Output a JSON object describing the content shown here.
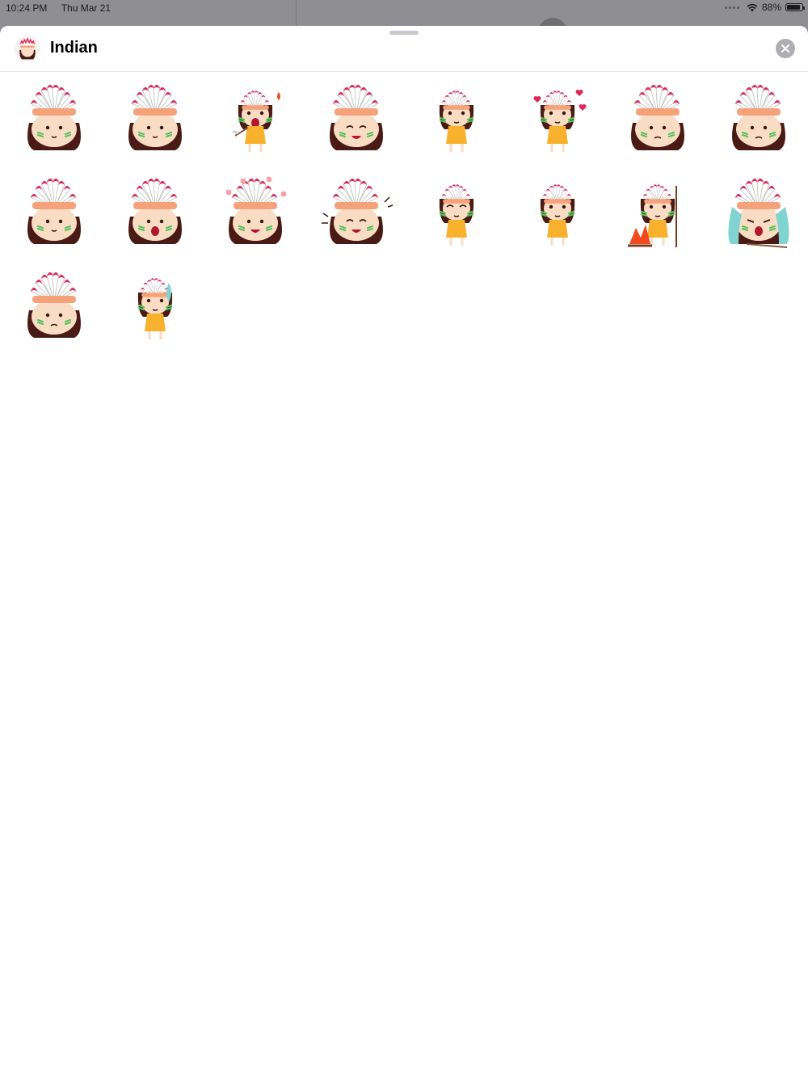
{
  "status_bar": {
    "time": "10:24 PM",
    "date": "Thu Mar 21",
    "battery_percent": "88%",
    "battery_level": 0.88,
    "icons": [
      "signal-dots-icon",
      "wifi-icon",
      "battery-icon"
    ]
  },
  "sheet": {
    "app_name": "Indian",
    "app_icon": "indian-girl-sticker-icon",
    "close_icon": "close-icon"
  },
  "stickers": [
    {
      "mood": "sipping"
    },
    {
      "mood": "hands-on-face"
    },
    {
      "mood": "angry-with-axe"
    },
    {
      "mood": "happy-wink"
    },
    {
      "mood": "arms-crossed"
    },
    {
      "mood": "in-love"
    },
    {
      "mood": "grumpy"
    },
    {
      "mood": "sulking"
    },
    {
      "mood": "unimpressed"
    },
    {
      "mood": "shocked"
    },
    {
      "mood": "flowers-laugh"
    },
    {
      "mood": "laughing"
    },
    {
      "mood": "standing-shy"
    },
    {
      "mood": "thinking"
    },
    {
      "mood": "campfire-spear"
    },
    {
      "mood": "crying"
    },
    {
      "mood": "bored"
    },
    {
      "mood": "sweating-sitting"
    }
  ],
  "colors": {
    "feather_white": "#ffffff",
    "feather_tip": "#e0265a",
    "headband": "#f5a27a",
    "skin": "#f9dcc4",
    "hair": "#4a1a14",
    "dress": "#f7b12c",
    "paint": "#57c35a",
    "tears": "#7fd3d0",
    "fire": "#f04a1e"
  }
}
